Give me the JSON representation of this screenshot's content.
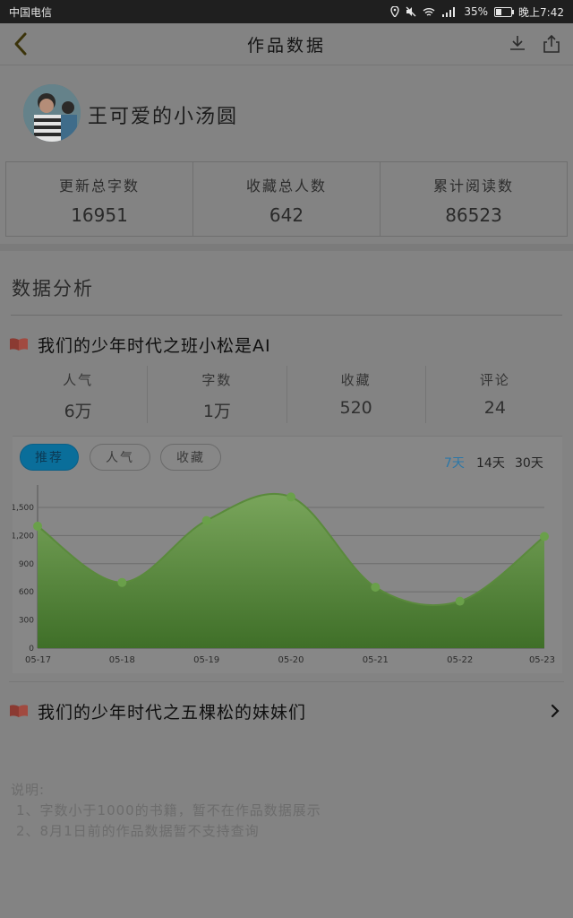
{
  "status_bar": {
    "carrier": "中国电信",
    "battery": "35%",
    "time": "晚上7:42"
  },
  "nav": {
    "title": "作品数据"
  },
  "author": {
    "name": "王可爱的小汤圆"
  },
  "summary": [
    {
      "label": "更新总字数",
      "value": "16951"
    },
    {
      "label": "收藏总人数",
      "value": "642"
    },
    {
      "label": "累计阅读数",
      "value": "86523"
    }
  ],
  "analysis": {
    "title": "数据分析"
  },
  "books": [
    {
      "title": "我们的少年时代之班小松是AI",
      "metrics": [
        {
          "label": "人气",
          "value": "6万"
        },
        {
          "label": "字数",
          "value": "1万"
        },
        {
          "label": "收藏",
          "value": "520"
        },
        {
          "label": "评论",
          "value": "24"
        }
      ]
    },
    {
      "title": "我们的少年时代之五棵松的妹妹们"
    }
  ],
  "chart_tabs": [
    "推荐",
    "人气",
    "收藏"
  ],
  "range_tabs": [
    "7天",
    "14天",
    "30天"
  ],
  "chart_data": {
    "type": "area",
    "categories": [
      "05-17",
      "05-18",
      "05-19",
      "05-20",
      "05-21",
      "05-22",
      "05-23"
    ],
    "values": [
      1300,
      700,
      1360,
      1610,
      650,
      500,
      1190
    ],
    "ylim": [
      0,
      1700
    ],
    "yticks": [
      0,
      300,
      600,
      900,
      1200,
      1500
    ],
    "ytick_labels": [
      "0",
      "300",
      "600",
      "900",
      "1,200",
      "1,500"
    ],
    "grid": true,
    "colors": {
      "line": "#5a8a3c",
      "fill_top": "#79a55b",
      "fill_bottom": "#3f6f28",
      "point": "#6aa04a"
    }
  },
  "notes": {
    "heading": "说明:",
    "lines": [
      "1、字数小于1000的书籍，暂不在作品数据展示",
      "2、8月1日前的作品数据暂不支持查询"
    ]
  }
}
